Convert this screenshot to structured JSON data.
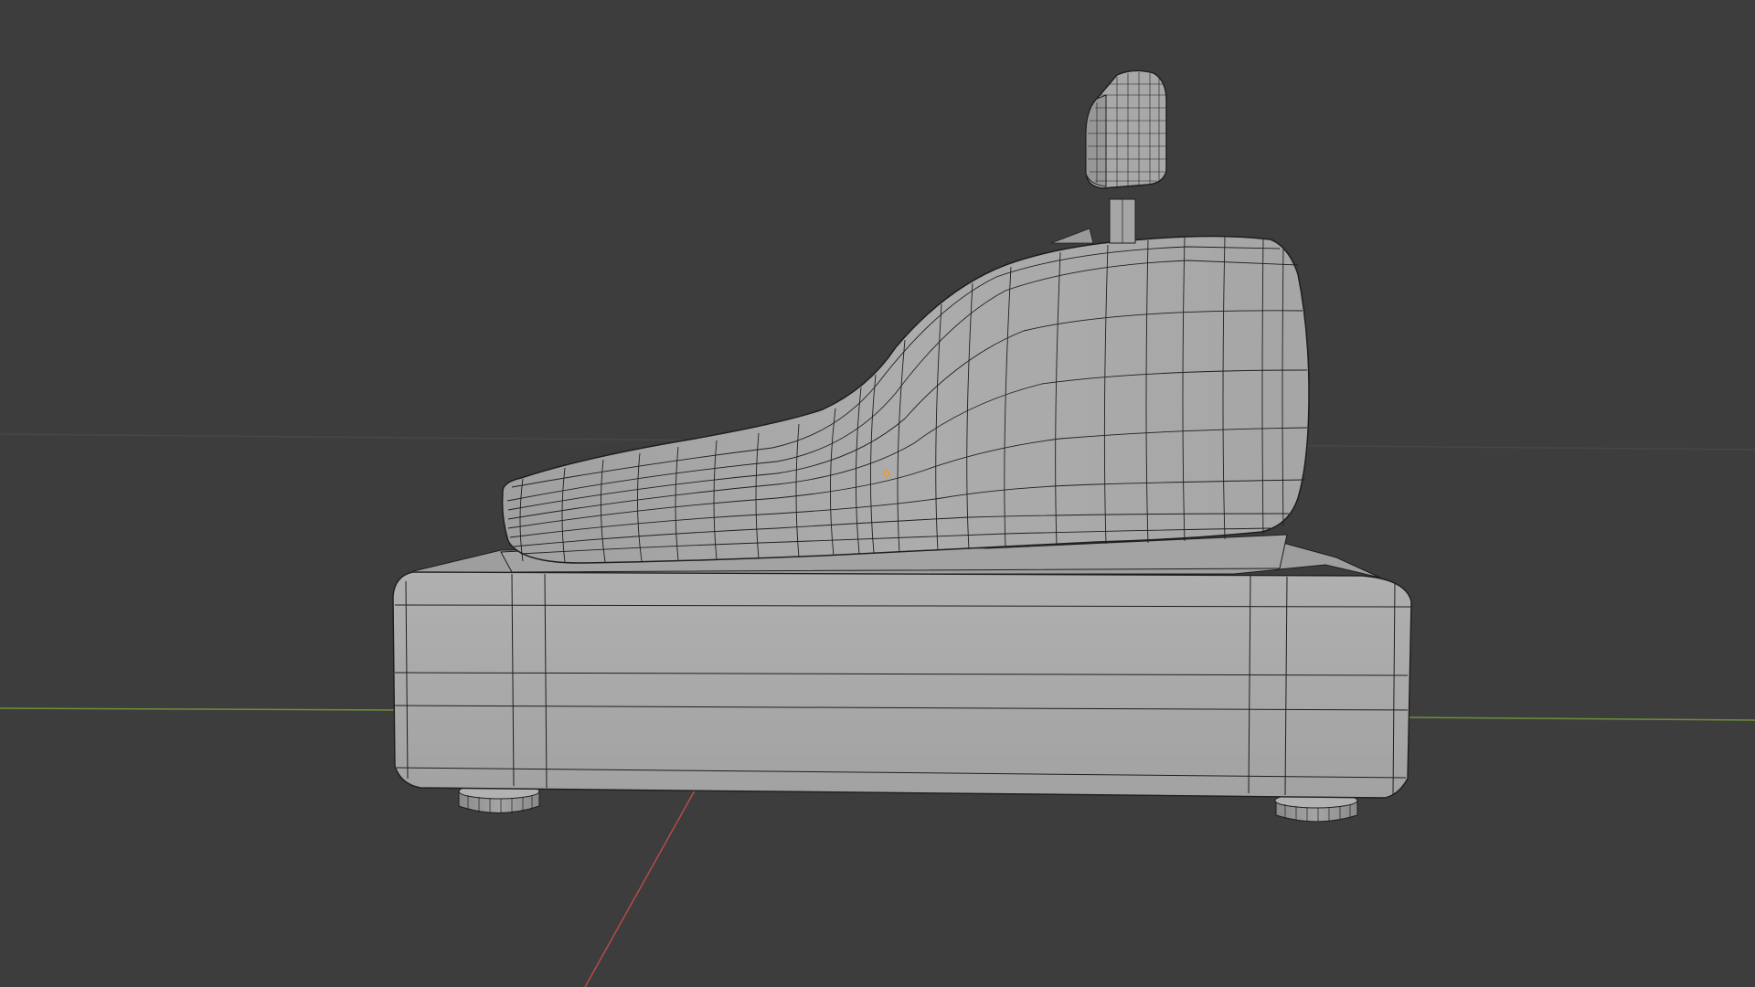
{
  "viewport": {
    "background_color": "#3d3d3d",
    "grid_horizon_color": "#474747",
    "axis_x_color": "#b84a4a",
    "axis_y_color": "#6f8f3a"
  },
  "model": {
    "name": "cash-register",
    "shading": "solid",
    "overlay": "wireframe",
    "body_color": "#a8a8a8",
    "edge_color": "#1e1e1e",
    "origin_color": "#f39a1d",
    "parts": [
      "base",
      "body",
      "display-pole",
      "display",
      "foot-left",
      "foot-right"
    ]
  }
}
